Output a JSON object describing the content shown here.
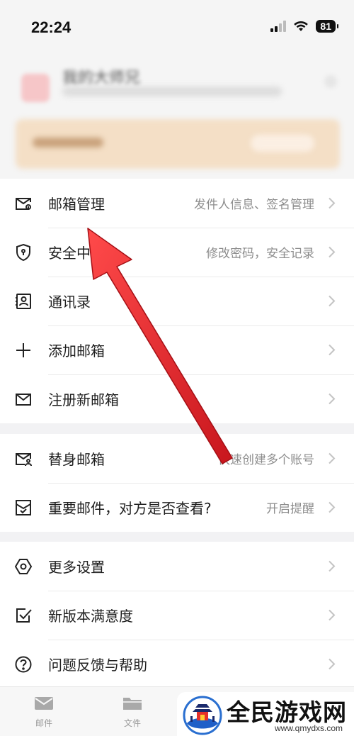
{
  "status_bar": {
    "time": "22:24",
    "battery": "81"
  },
  "profile": {
    "name_blurred": "我的大师兄"
  },
  "menu_groups": [
    [
      {
        "id": "mailbox-management",
        "icon": "envelope-gear-icon",
        "label": "邮箱管理",
        "detail": "发件人信息、签名管理"
      },
      {
        "id": "security-center",
        "icon": "shield-lock-icon",
        "label": "安全中心",
        "detail": "修改密码，安全记录"
      },
      {
        "id": "contacts",
        "icon": "contact-card-icon",
        "label": "通讯录",
        "detail": ""
      },
      {
        "id": "add-mailbox",
        "icon": "plus-icon",
        "label": "添加邮箱",
        "detail": ""
      },
      {
        "id": "register-mailbox",
        "icon": "envelope-icon",
        "label": "注册新邮箱",
        "detail": ""
      }
    ],
    [
      {
        "id": "alias-mailbox",
        "icon": "envelope-person-icon",
        "label": "替身邮箱",
        "detail": "快速创建多个账号"
      },
      {
        "id": "read-receipt",
        "icon": "envelope-check-icon",
        "label": "重要邮件，对方是否查看?",
        "detail": "开启提醒"
      }
    ],
    [
      {
        "id": "more-settings",
        "icon": "hexagon-gear-icon",
        "label": "更多设置",
        "detail": ""
      },
      {
        "id": "satisfaction",
        "icon": "checkbox-icon",
        "label": "新版本满意度",
        "detail": ""
      },
      {
        "id": "help",
        "icon": "question-circle-icon",
        "label": "问题反馈与帮助",
        "detail": ""
      }
    ]
  ],
  "tab_bar": [
    {
      "id": "mail",
      "icon": "mail-icon",
      "label": "邮件"
    },
    {
      "id": "files",
      "icon": "folder-icon",
      "label": "文件"
    }
  ],
  "watermark": {
    "title": "全民游戏网",
    "url": "www.qmydxs.com"
  },
  "colors": {
    "arrow": "#e3252b",
    "chevron": "#c4c4c4",
    "detail_text": "#8d8d8d"
  }
}
